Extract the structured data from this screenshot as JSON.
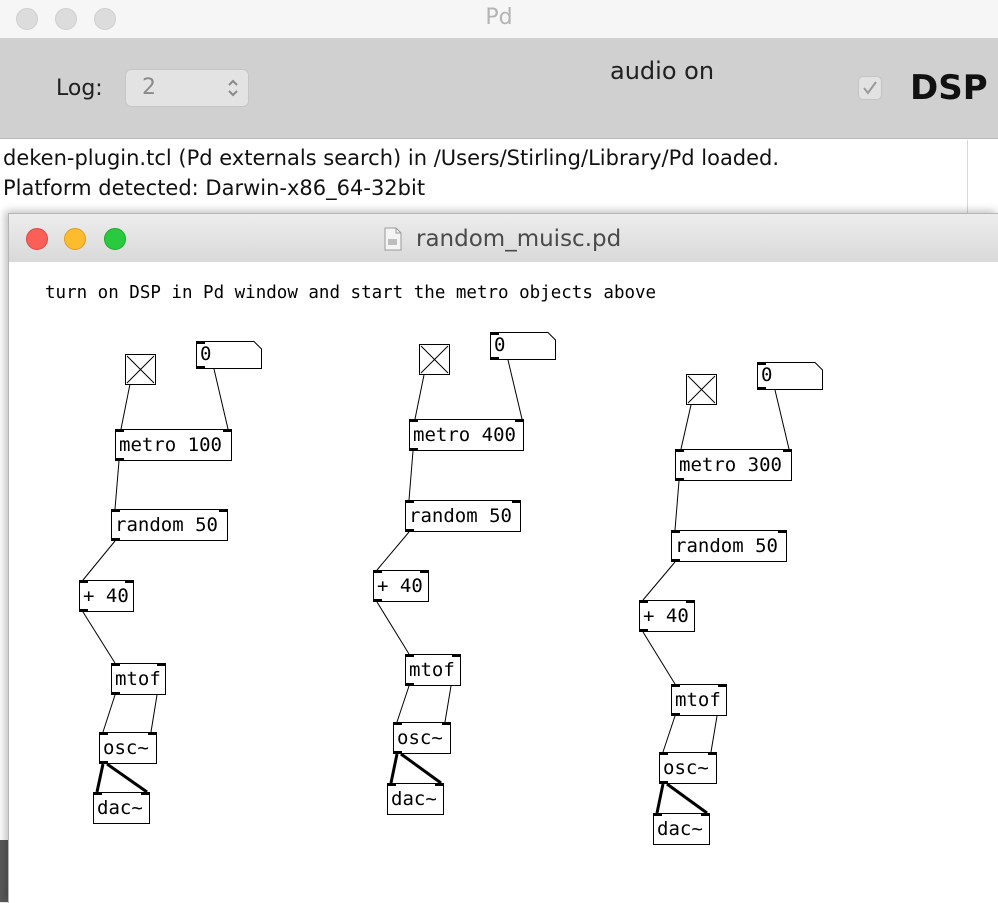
{
  "pd_window": {
    "title": "Pd",
    "log_label": "Log:",
    "log_level": "2",
    "audio_status": "audio on",
    "dsp_label": "DSP",
    "console": [
      "deken-plugin.tcl (Pd externals search) in /Users/Stirling/Library/Pd loaded.",
      "Platform detected: Darwin-x86_64-32bit"
    ]
  },
  "patch": {
    "filename": "random_muisc.pd",
    "comment": "turn on DSP in Pd window and start the metro objects above",
    "chains": [
      {
        "number": "0",
        "metro": "metro 100",
        "random": "random 50",
        "add": "+ 40",
        "mtof": "mtof",
        "osc": "osc~",
        "dac": "dac~"
      },
      {
        "number": "0",
        "metro": "metro 400",
        "random": "random 50",
        "add": "+ 40",
        "mtof": "mtof",
        "osc": "osc~",
        "dac": "dac~"
      },
      {
        "number": "0",
        "metro": "metro 300",
        "random": "random 50",
        "add": "+ 40",
        "mtof": "mtof",
        "osc": "osc~",
        "dac": "dac~"
      }
    ]
  },
  "colors": {
    "close": "#fc5f57",
    "minimize": "#fdbc2e",
    "maximize": "#29c940"
  },
  "icons": [
    "document-icon",
    "checkmark-icon",
    "stepper-arrows-icon"
  ]
}
